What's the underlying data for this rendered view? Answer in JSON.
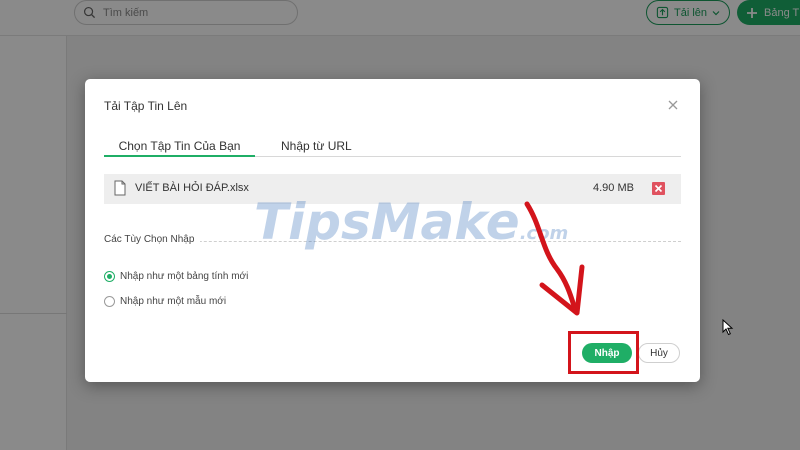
{
  "app": {
    "search": {
      "placeholder": "Tìm kiếm",
      "icon": "search-icon"
    },
    "upload_button": {
      "label": "Tải lên",
      "icon": "upload-icon",
      "chevron": "chevron-down-icon"
    },
    "new_sheet_button": {
      "label": "Bảng T",
      "icon": "plus-icon"
    }
  },
  "dialog": {
    "title": "Tải Tập Tin Lên",
    "close_icon": "close-icon",
    "tabs": [
      {
        "label": "Chọn Tập Tin Của Bạn",
        "active": true
      },
      {
        "label": "Nhập từ URL",
        "active": false
      }
    ],
    "file": {
      "icon": "file-icon",
      "name": "VIẾT BÀI HỎI ĐÁP.xlsx",
      "size": "4.90 MB",
      "remove_icon": "remove-icon"
    },
    "options": {
      "heading": "Các Tùy Chọn Nhập",
      "items": [
        {
          "label": "Nhập như một bảng tính mới",
          "selected": true
        },
        {
          "label": "Nhập như một mẫu mới",
          "selected": false
        }
      ]
    },
    "import_button": {
      "label": "Nhập"
    },
    "cancel_button": {
      "label": "Hủy"
    }
  },
  "watermark": {
    "text": "TipsMake",
    "domain": ".com"
  },
  "colors": {
    "accent": "#1fae66",
    "annotation": "#d3141b",
    "remove": "#e0525f",
    "watermark": "#2f6ab6"
  }
}
